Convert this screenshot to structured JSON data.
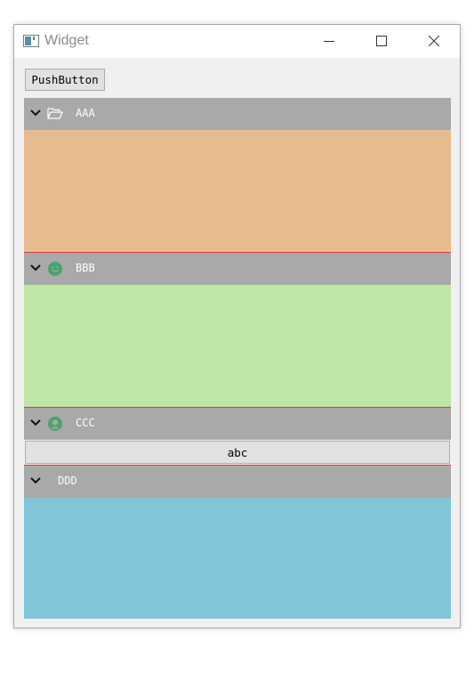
{
  "window": {
    "title": "Widget"
  },
  "toolbar": {
    "push_button_label": "PushButton"
  },
  "sections": [
    {
      "label": "AAA",
      "icon": "folder-open-icon",
      "panel_color": "#e8bb8f"
    },
    {
      "label": "BBB",
      "icon": "smiley-icon",
      "panel_color": "#bee6a4"
    },
    {
      "label": "CCC",
      "icon": "user-circle-icon",
      "content_button_label": "abc"
    },
    {
      "label": "DDD",
      "icon": "",
      "panel_color": "#80c5d8"
    }
  ],
  "colors": {
    "header_bg": "#a9a9a9",
    "separator": "#e03a3a",
    "icon_green": "#4aa36b"
  }
}
